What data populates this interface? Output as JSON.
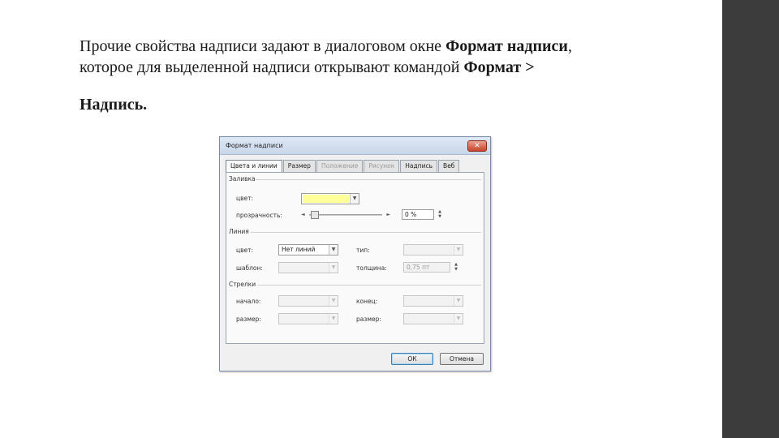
{
  "slide": {
    "text_line1_plain": "Прочие свойства надписи задают в диалоговом окне ",
    "text_line1_bold": "Формат надписи",
    "text_line1_end": ",",
    "text_line2_plain": "которое для выделенной надписи открывают командой ",
    "text_line2_bold": "Формат >",
    "text_line3_bold": "Надпись."
  },
  "dialog": {
    "title": "Формат надписи",
    "close_glyph": "✕",
    "tabs": [
      {
        "label": "Цвета и линии",
        "state": "active"
      },
      {
        "label": "Размер",
        "state": "normal"
      },
      {
        "label": "Положение",
        "state": "disabled"
      },
      {
        "label": "Рисунок",
        "state": "disabled"
      },
      {
        "label": "Надпись",
        "state": "normal"
      },
      {
        "label": "Веб",
        "state": "normal"
      }
    ],
    "fill": {
      "group": "Заливка",
      "color_label": "цвет:",
      "color_value": "#ffff99",
      "transparency_label": "прозрачность:",
      "transparency_value": "0 %",
      "transparency_level": 0
    },
    "line": {
      "group": "Линия",
      "color_label": "цвет:",
      "color_value": "Нет линий",
      "type_label": "тип:",
      "pattern_label": "шаблон:",
      "thickness_label": "толщина:",
      "thickness_value": "0,75 пт"
    },
    "arrows": {
      "group": "Стрелки",
      "start_label": "начало:",
      "end_label": "конец:",
      "size_label": "размер:",
      "size_label2": "размер:"
    },
    "buttons": {
      "ok": "ОК",
      "cancel": "Отмена"
    },
    "glyphs": {
      "dropdown": "▼",
      "left": "◄",
      "right": "►",
      "up": "▲",
      "down": "▼"
    }
  }
}
